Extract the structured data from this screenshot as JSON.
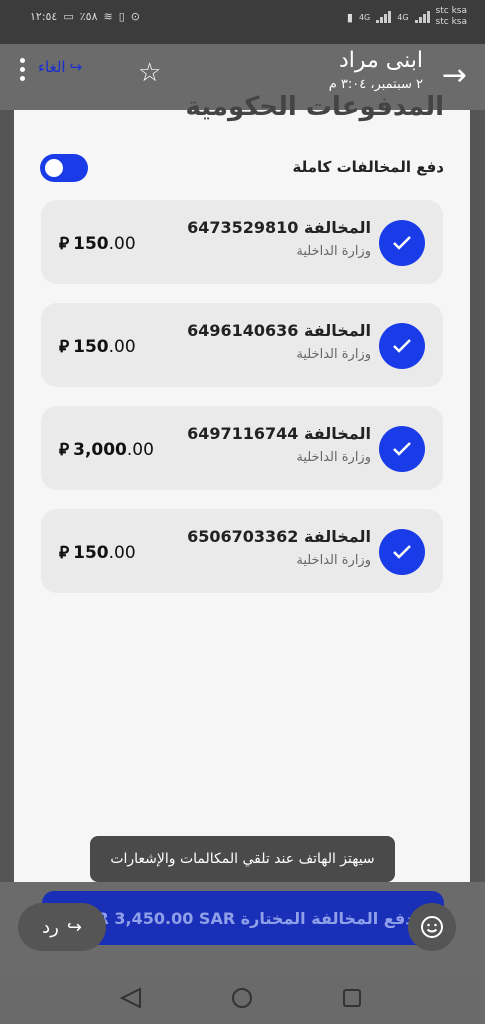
{
  "status_bar": {
    "time": "١٢:٥٤",
    "battery": "٪٥٨",
    "carrier_1": "stc ksa",
    "carrier_2": "stc ksa",
    "network_1": "4G",
    "network_2": "4G"
  },
  "chat_overlay": {
    "contact_name": "ابنى مراد",
    "timestamp": "٢ سبتمبر، ٣:٠٤ م",
    "cancel_label": "الغاء"
  },
  "page": {
    "title": "المدفوعات الحكومية",
    "toggle_label": "دفع المخالفات كاملة"
  },
  "violations": [
    {
      "title": "المخالفة 6473529810",
      "issuer": "وزارة الداخلية",
      "amount_main": "150",
      "amount_dec": ".00"
    },
    {
      "title": "المخالفة 6496140636",
      "issuer": "وزارة الداخلية",
      "amount_main": "150",
      "amount_dec": ".00"
    },
    {
      "title": "المخالفة 6497116744",
      "issuer": "وزارة الداخلية",
      "amount_main": "3,000",
      "amount_dec": ".00"
    },
    {
      "title": "المخالفة 6506703362",
      "issuer": "وزارة الداخلية",
      "amount_main": "150",
      "amount_dec": ".00"
    }
  ],
  "currency_symbol": "⃁",
  "toast": "سيهتز الهاتف عند تلقي المكالمات والإشعارات",
  "pay_button": "SAR 3,450.00 SAR دفع المخالفة المختارة",
  "reply_label": "رد",
  "colors": {
    "accent": "#1a3ce8",
    "card": "#eaeaea",
    "overlay": "#6b6b6b"
  }
}
